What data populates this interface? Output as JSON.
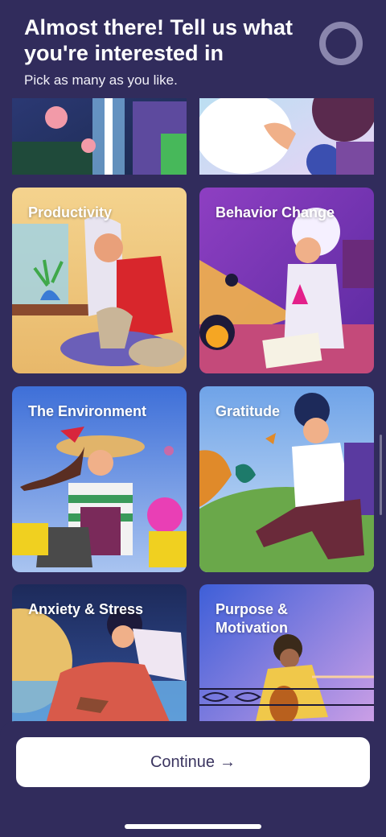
{
  "header": {
    "title": "Almost there! Tell us what you're interested in",
    "subtitle": "Pick as many as you like."
  },
  "topics": [
    {
      "label": ""
    },
    {
      "label": ""
    },
    {
      "label": "Productivity"
    },
    {
      "label": "Behavior Change"
    },
    {
      "label": "The Environment"
    },
    {
      "label": "Gratitude"
    },
    {
      "label": "Anxiety & Stress"
    },
    {
      "label": "Purpose & Motivation"
    }
  ],
  "footer": {
    "continue_label": "Continue",
    "continue_arrow": "→"
  },
  "colors": {
    "background": "#312c5c",
    "button_bg": "#ffffff",
    "button_text": "#3b3560"
  }
}
